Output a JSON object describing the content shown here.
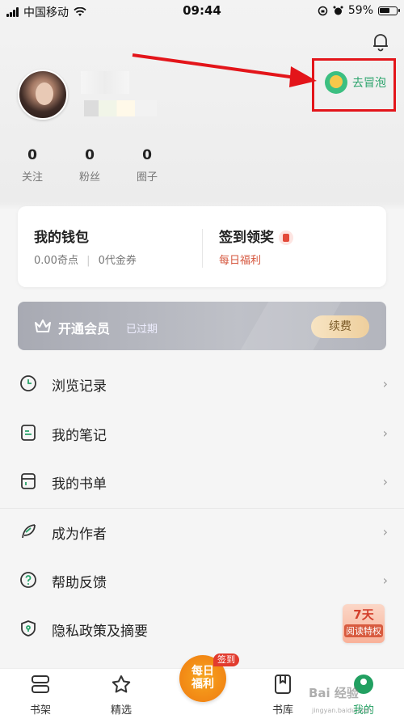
{
  "status_bar": {
    "carrier": "中国移动",
    "time": "09:44",
    "battery": "59%"
  },
  "profile": {
    "followers_stats": [
      {
        "value": "0",
        "label": "关注"
      },
      {
        "value": "0",
        "label": "粉丝"
      },
      {
        "value": "0",
        "label": "圈子"
      }
    ],
    "bubble_label": "去冒泡"
  },
  "wallet": {
    "title": "我的钱包",
    "points": "0.00奇点",
    "coupons": "0代金券",
    "checkin_title": "签到领奖",
    "checkin_sub": "每日福利"
  },
  "member": {
    "title": "开通会员",
    "status": "已过期",
    "renew": "续费"
  },
  "menu": [
    {
      "label": "浏览记录",
      "icon": "clock-icon"
    },
    {
      "label": "我的笔记",
      "icon": "note-icon"
    },
    {
      "label": "我的书单",
      "icon": "booklist-icon"
    },
    {
      "label": "成为作者",
      "icon": "feather-icon"
    },
    {
      "label": "帮助反馈",
      "icon": "help-icon"
    },
    {
      "label": "隐私政策及摘要",
      "icon": "shield-icon"
    }
  ],
  "promo": {
    "days": "7天",
    "text": "阅读特权"
  },
  "nav": {
    "tabs": [
      {
        "label": "书架",
        "icon": "shelf-icon"
      },
      {
        "label": "精选",
        "icon": "star-icon"
      },
      {
        "label": "书库",
        "icon": "library-icon"
      },
      {
        "label": "我的",
        "icon": "profile-icon"
      }
    ],
    "center_line1": "每日",
    "center_line2": "福利",
    "center_tag": "签到"
  },
  "watermark": {
    "text": "Bai 经验",
    "sub": "jingyan.baidu.com"
  },
  "colors": {
    "accent": "#22a061",
    "highlight": "#e3151a",
    "orange": "#f07a10"
  }
}
